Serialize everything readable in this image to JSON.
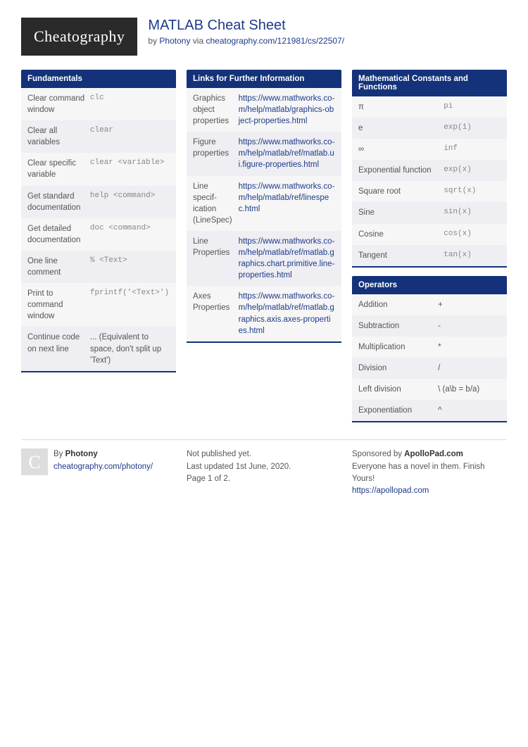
{
  "logo": "Cheatography",
  "title": "MATLAB Cheat Sheet",
  "byline_prefix": "by ",
  "author": "Photony",
  "byline_mid": " via ",
  "source_url": "cheatography.com/121981/cs/22507/",
  "cards": {
    "fundamentals": {
      "header": "Fundamentals",
      "rows": [
        {
          "l": "Clear command window",
          "r": "clc",
          "code": true
        },
        {
          "l": "Clear all variables",
          "r": "clear",
          "code": true
        },
        {
          "l": "Clear specific variable",
          "r": "clear <variable>",
          "code": true
        },
        {
          "l": "Get standard documentation",
          "r": "help <command>",
          "code": true
        },
        {
          "l": "Get detailed documentation",
          "r": "doc <command>",
          "code": true
        },
        {
          "l": "One line comment",
          "r": "% <Text>",
          "code": true
        },
        {
          "l": "Print to command window",
          "r": "fprintf('<Text>')",
          "code": true
        },
        {
          "l": "Continue code on next line",
          "r": "... (Equivalent to space, don't split up 'Text')",
          "code": false
        }
      ]
    },
    "links": {
      "header": "Links for Further Information",
      "rows": [
        {
          "l": "Graphics object properties",
          "r": "https://www.mathworks.co­m/help/matlab/graphics-obje­ct-properties.html",
          "link": true
        },
        {
          "l": "Figure properties",
          "r": "https://www.mathworks.co­m/help/matlab/ref/matlab.ui.fi­gure-properties.html",
          "link": true
        },
        {
          "l": "Line specif­ication (LineSpec)",
          "r": "https://www.mathworks.co­m/help/matlab/ref/linesp­ec.html",
          "link": true
        },
        {
          "l": "Line Properties",
          "r": "https://www.mathworks.co­m/help/matlab/ref/matlab.gr­aphics.chart.primitive.line-pr­operties.html",
          "link": true
        },
        {
          "l": "Axes Properties",
          "r": "https://www.mathworks.co­m/help/matlab/ref/matlab.gr­aphics.axis.axes-propert­ies.html",
          "link": true
        }
      ]
    },
    "math": {
      "header": "Mathematical Constants and Functions",
      "rows": [
        {
          "l": "π",
          "r": "pi",
          "code": true
        },
        {
          "l": "e",
          "r": "exp(1)",
          "code": true
        },
        {
          "l": "∞",
          "r": "inf",
          "code": true
        },
        {
          "l": "Exponential function",
          "r": "exp(x)",
          "code": true
        },
        {
          "l": "Square root",
          "r": "sqrt(x)",
          "code": true
        },
        {
          "l": "Sine",
          "r": "sin(x)",
          "code": true
        },
        {
          "l": "Cosine",
          "r": "cos(x)",
          "code": true
        },
        {
          "l": "Tangent",
          "r": "tan(x)",
          "code": true
        }
      ]
    },
    "operators": {
      "header": "Operators",
      "rows": [
        {
          "l": "Addition",
          "r": "+",
          "code": false
        },
        {
          "l": "Subtraction",
          "r": "-",
          "code": false
        },
        {
          "l": "Multiplication",
          "r": "*",
          "code": false
        },
        {
          "l": "Division",
          "r": "/",
          "code": false
        },
        {
          "l": "Left division",
          "r": "\\   (a\\b = b/a)",
          "code": false
        },
        {
          "l": "Exponentiation",
          "r": "^",
          "code": false
        }
      ]
    }
  },
  "footer": {
    "by_label": "By ",
    "by_author": "Photony",
    "by_link": "cheatography.com/photony/",
    "pub1": "Not published yet.",
    "pub2": "Last updated 1st June, 2020.",
    "pub3": "Page 1 of 2.",
    "sponsor_label": "Sponsored by ",
    "sponsor_name": "ApolloPad.com",
    "sponsor_text": "Everyone has a novel in them. Finish Yours!",
    "sponsor_link": "https://apollopad.com"
  },
  "avatar_letter": "C"
}
